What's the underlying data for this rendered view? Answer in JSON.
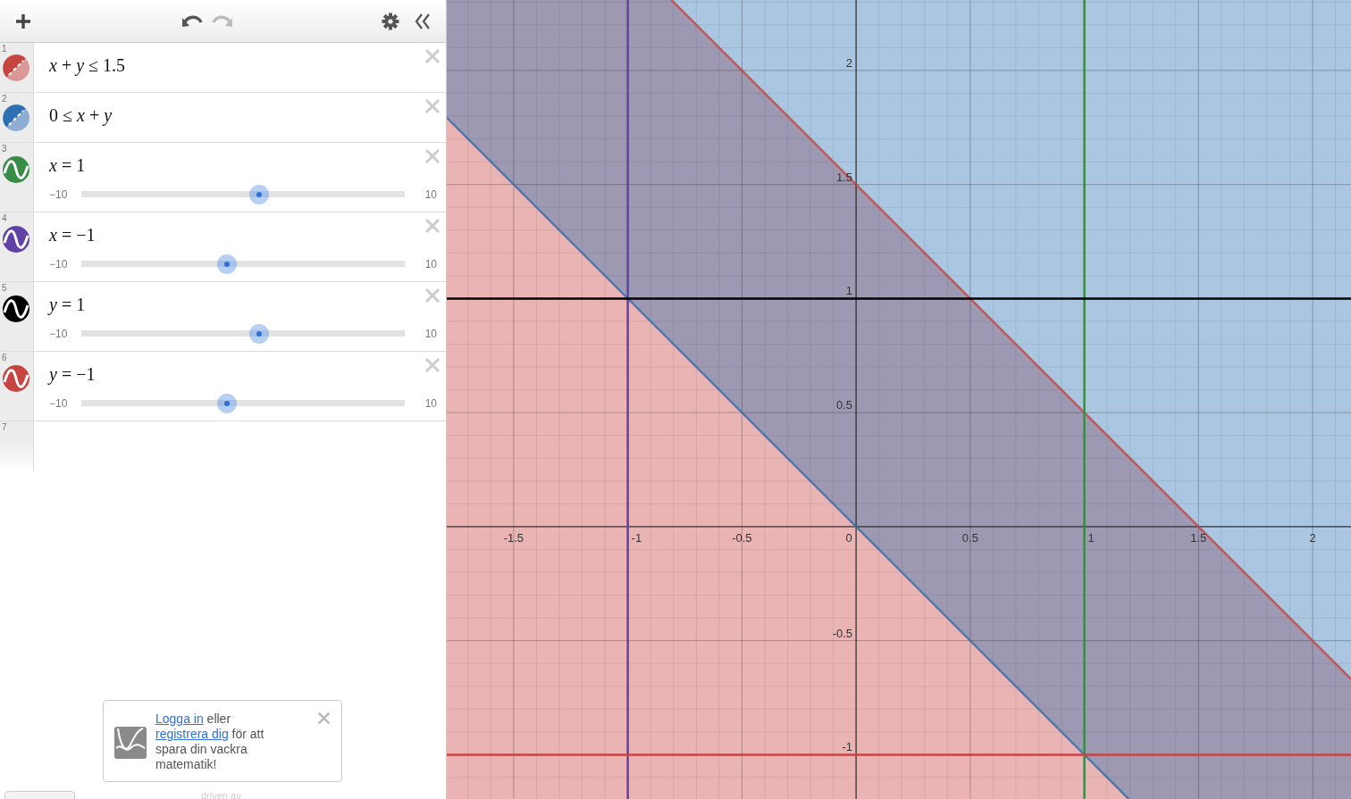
{
  "expressions": [
    {
      "number": "1",
      "kind": "inequality",
      "latex": "*x* + *y* ≤ 1.5",
      "color": "#c74440"
    },
    {
      "number": "2",
      "kind": "inequality",
      "latex": "0 ≤ *x* + *y*",
      "color": "#2d70b3"
    },
    {
      "number": "3",
      "kind": "vertical",
      "latex": "*x* = 1",
      "color": "#388c46",
      "slider": {
        "min": "−10",
        "max": "10",
        "level": 0.55
      }
    },
    {
      "number": "4",
      "kind": "vertical",
      "latex": "*x* = −1",
      "color": "#6042a6",
      "slider": {
        "min": "−10",
        "max": "10",
        "level": 0.45
      }
    },
    {
      "number": "5",
      "kind": "horizontal",
      "latex": "*y* = 1",
      "color": "#000000",
      "slider": {
        "min": "−10",
        "max": "10",
        "level": 0.55
      }
    },
    {
      "number": "6",
      "kind": "horizontal",
      "latex": "*y* = −1",
      "color": "#c74440",
      "slider": {
        "min": "−10",
        "max": "10",
        "level": 0.45
      }
    }
  ],
  "empty_row": {
    "number": "7"
  },
  "login_prompt": {
    "link_1": "Logga in",
    "text_1": "eller",
    "link_2": "registrera dig",
    "text_2": "för att spara din vackra matematik!"
  },
  "footer": {
    "text": "driven av"
  },
  "graph": {
    "x_ticks": [
      "-1.5",
      "-1",
      "-0.5",
      "0",
      "0.5",
      "1",
      "1.5",
      "2"
    ],
    "y_ticks": [
      "2",
      "1.5",
      "1",
      "0.5",
      "-0.5",
      "-1"
    ]
  }
}
